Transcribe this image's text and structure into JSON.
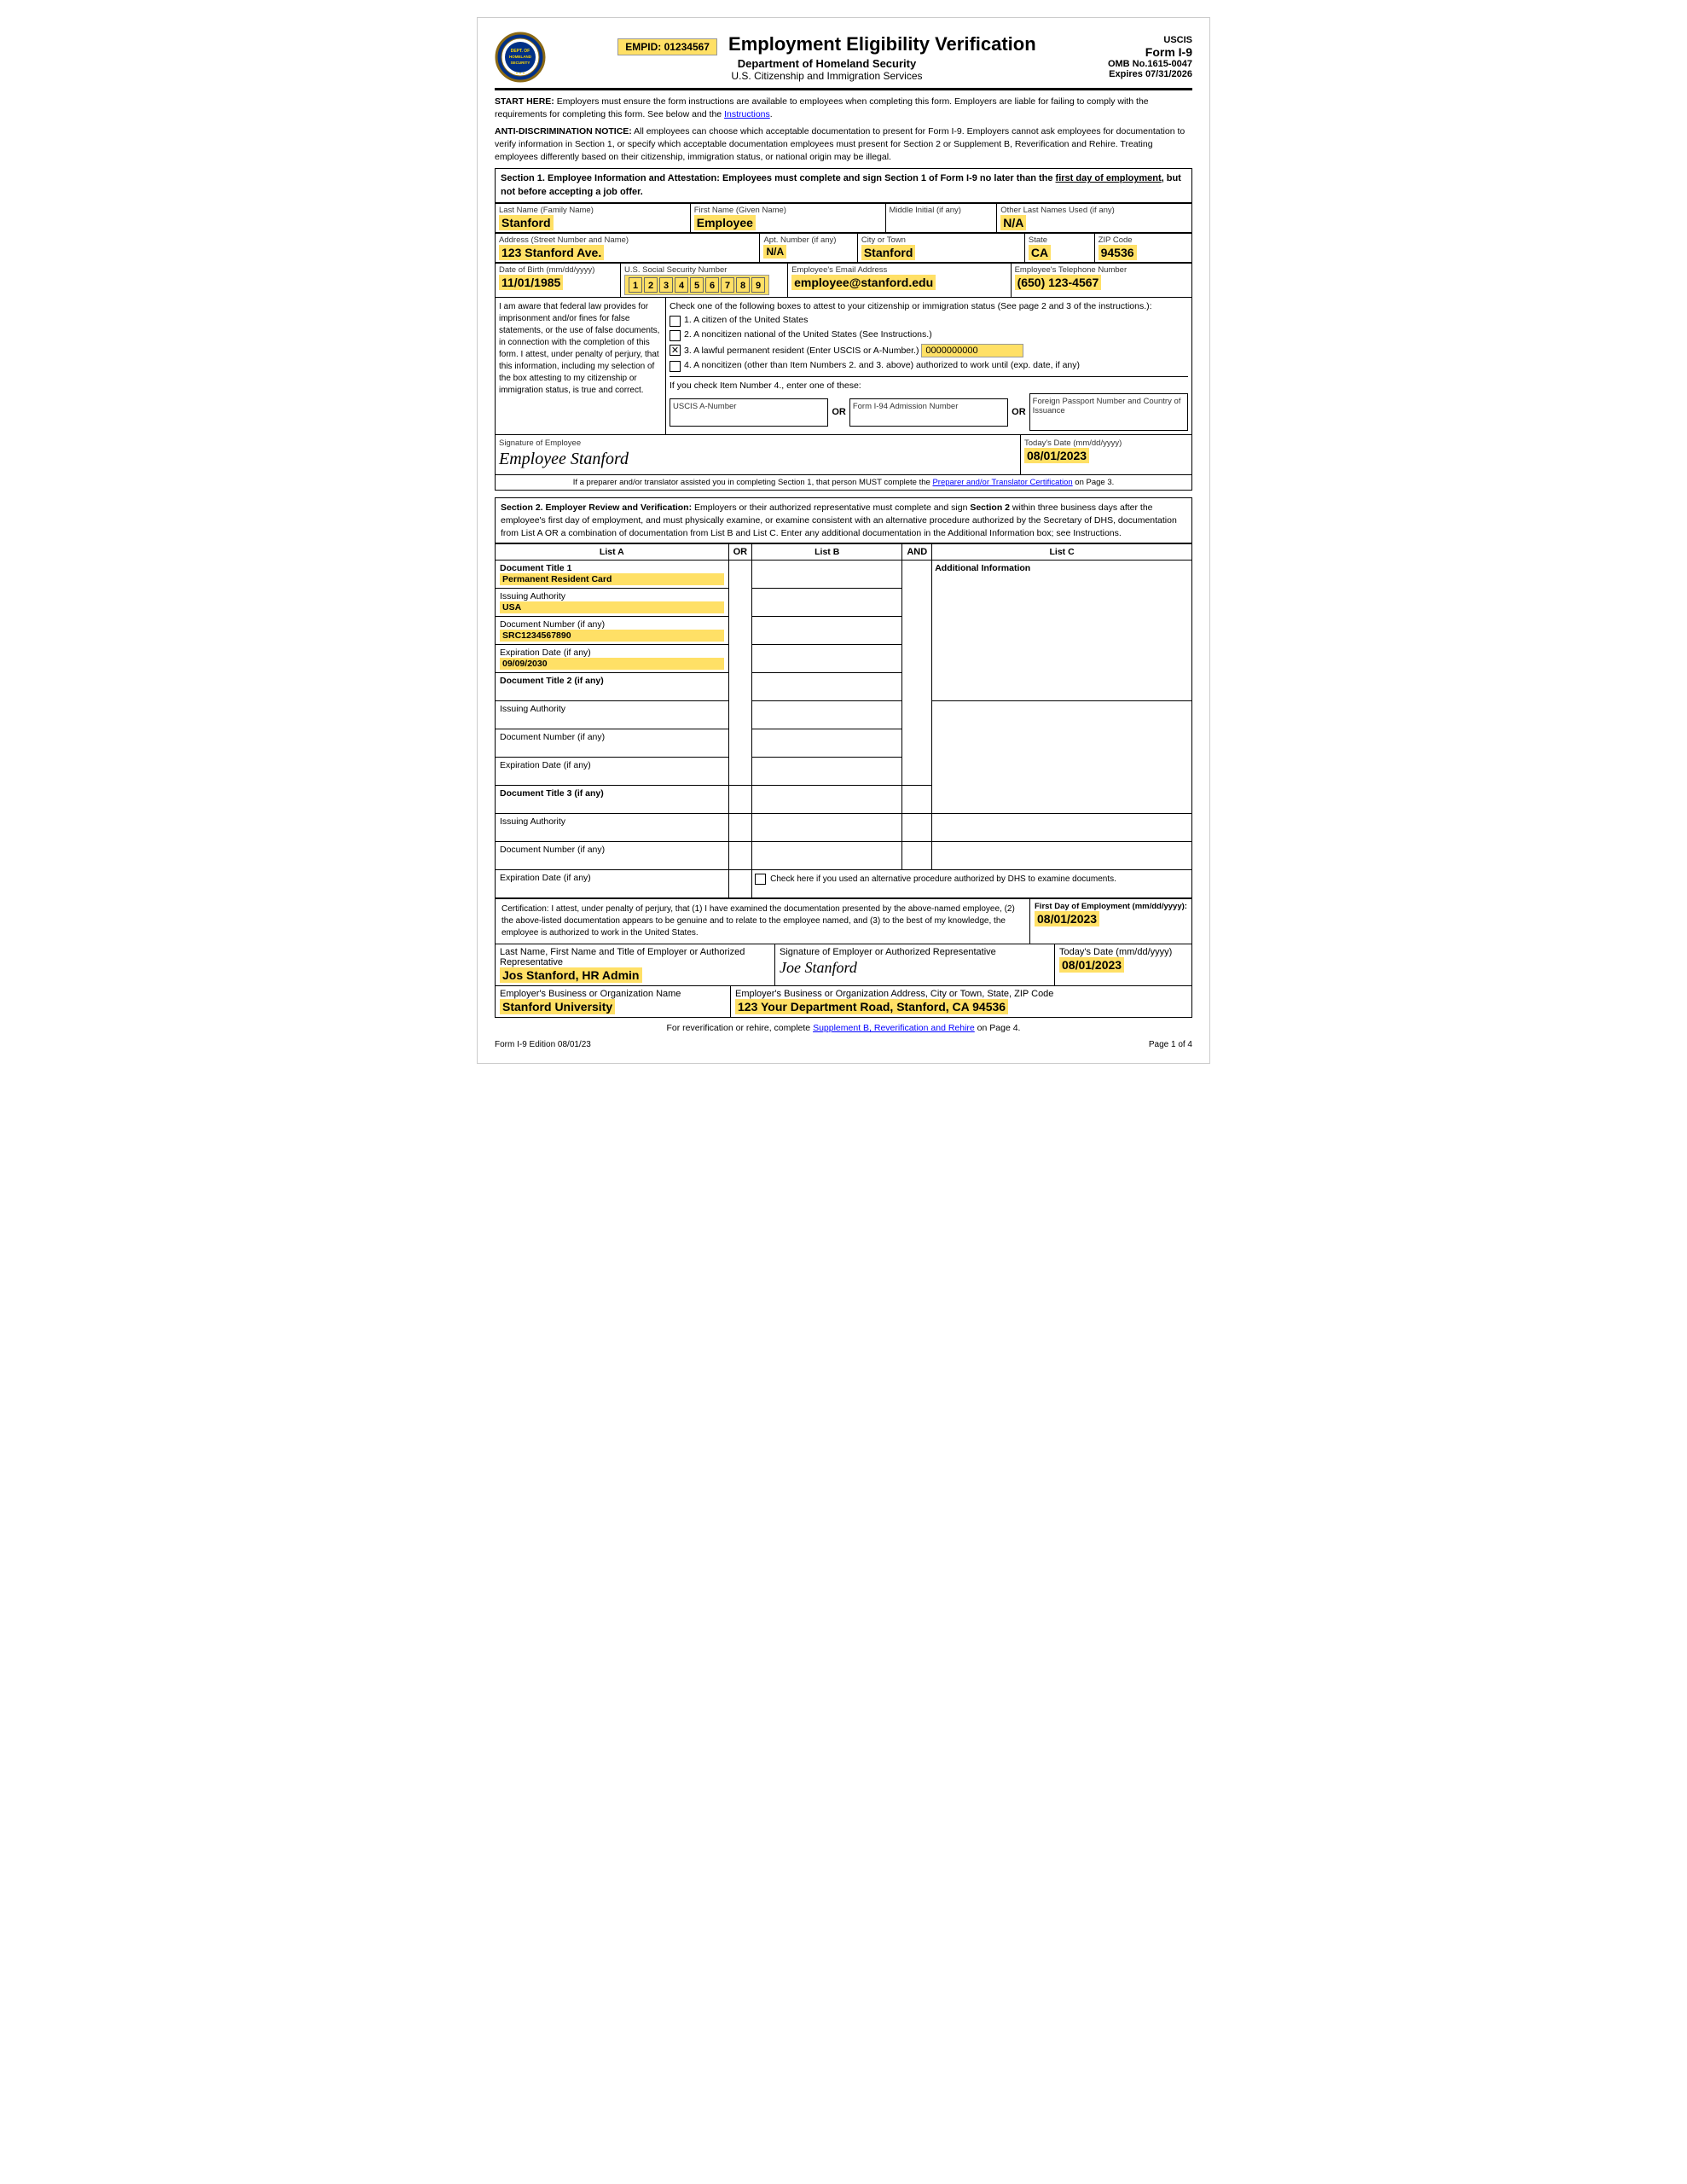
{
  "header": {
    "empid_label": "EMPID: 01234567",
    "title": "Employment Eligibility Verification",
    "dept": "Department of Homeland Security",
    "agency": "U.S. Citizenship and Immigration Services",
    "form_label": "USCIS",
    "form_num": "Form I-9",
    "omb": "OMB No.1615-0047",
    "expires": "Expires 07/31/2026"
  },
  "notices": {
    "start_here": "START HERE:  Employers must ensure the form instructions are available to employees when completing this form.  Employers are liable for failing to comply with the requirements for completing this form.  See below and the Instructions.",
    "anti_disc_label": "ANTI-DISCRIMINATION NOTICE:",
    "anti_disc_text": "  All employees can choose which acceptable documentation to present for Form I-9.  Employers cannot ask employees for documentation to verify information in Section 1, or specify which acceptable documentation employees must present for Section 2 or Supplement B, Reverification and Rehire.  Treating employees differently based on their citizenship, immigration status, or national origin may be illegal."
  },
  "section1": {
    "header": "Section 1. Employee Information and Attestation:",
    "header_text": " Employees must complete and sign Section 1 of Form I-9 no later than the ",
    "header_bold": "first day of employment",
    "header_text2": ", but not before accepting a job offer.",
    "fields": {
      "last_name_label": "Last Name (Family Name)",
      "last_name_value": "Stanford",
      "first_name_label": "First Name (Given Name)",
      "first_name_value": "Employee",
      "middle_initial_label": "Middle Initial (if any)",
      "middle_initial_value": "",
      "other_names_label": "Other Last Names Used (if any)",
      "other_names_value": "N/A",
      "address_label": "Address (Street Number and Name)",
      "address_value": "123 Stanford Ave.",
      "apt_label": "Apt. Number (if any)",
      "apt_value": "N/A",
      "city_label": "City or Town",
      "city_value": "Stanford",
      "state_label": "State",
      "state_value": "CA",
      "zip_label": "ZIP Code",
      "zip_value": "94536",
      "dob_label": "Date of Birth (mm/dd/yyyy)",
      "dob_value": "11/01/1985",
      "ssn_label": "U.S. Social Security Number",
      "ssn_digits": [
        "1",
        "2",
        "3",
        "4",
        "5",
        "6",
        "7",
        "8",
        "9"
      ],
      "email_label": "Employee's Email Address",
      "email_value": "employee@stanford.edu",
      "phone_label": "Employee's Telephone Number",
      "phone_value": "(650) 123-4567"
    },
    "attestation_left": "I am aware that federal law provides for imprisonment and/or fines for false statements, or the use of false documents, in connection with the completion of this form.  I attest, under penalty of perjury, that this information, including my selection of the box attesting to my citizenship or immigration status, is true and correct.",
    "checkboxes": [
      {
        "id": 1,
        "checked": false,
        "text": "A citizen of the United States"
      },
      {
        "id": 2,
        "checked": false,
        "text": "A noncitizen national of the United States (See Instructions.)"
      },
      {
        "id": 3,
        "checked": true,
        "text": "A lawful permanent resident (Enter USCIS or A-Number.)",
        "field": "0000000000"
      },
      {
        "id": 4,
        "checked": false,
        "text": "A noncitizen (other than Item Numbers 2. and 3. above) authorized to work until (exp. date, if any)"
      }
    ],
    "item4_instruction": "If you check Item Number 4., enter one of these:",
    "uscis_a_label": "USCIS A-Number",
    "form_i94_label": "Form I-94 Admission Number",
    "passport_label": "Foreign Passport Number and Country of Issuance",
    "or_text": "OR",
    "signature_label": "Signature of Employee",
    "signature_value": "Employee Stanford",
    "todays_date_label": "Today's Date (mm/dd/yyyy)",
    "todays_date_value": "08/01/2023",
    "preparer_notice": "If a preparer and/or translator assisted you in completing Section 1, that person MUST complete the Preparer and/or Translator Certification on Page 3."
  },
  "section2": {
    "header": "Section 2. Employer Review and Verification:",
    "header_text": " Employers or their authorized representative must complete and sign Section 2 within three business days after the employee's first day of employment, and must physically examine, or examine consistent with an alternative procedure authorized by the Secretary of DHS, documentation from List A OR a combination of documentation from List B and List C.  Enter any additional documentation in the Additional Information box; see Instructions.",
    "list_a_label": "List A",
    "list_b_label": "List B",
    "list_c_label": "List C",
    "or_label": "OR",
    "and_label": "AND",
    "additional_info_label": "Additional Information",
    "rows": {
      "doc_title_1_label": "Document Title 1",
      "doc_title_1_value": "Permanent Resident Card",
      "issuing_auth_1_label": "Issuing Authority",
      "issuing_auth_1_value": "USA",
      "doc_num_1_label": "Document Number (if any)",
      "doc_num_1_value": "SRC1234567890",
      "exp_date_1_label": "Expiration Date (if any)",
      "exp_date_1_value": "09/09/2030",
      "doc_title_2_label": "Document Title 2 (if any)",
      "doc_title_2_value": "",
      "issuing_auth_2_label": "Issuing Authority",
      "issuing_auth_2_value": "",
      "doc_num_2_label": "Document Number (if any)",
      "doc_num_2_value": "",
      "exp_date_2_label": "Expiration Date (if any)",
      "exp_date_2_value": "",
      "doc_title_3_label": "Document Title 3 (if any)",
      "doc_title_3_value": "",
      "issuing_auth_3_label": "Issuing Authority",
      "issuing_auth_3_value": "",
      "doc_num_3_label": "Document Number (if any)",
      "doc_num_3_value": "",
      "exp_date_3_label": "Expiration Date (if any)",
      "exp_date_3_value": ""
    },
    "alt_proc_text": "Check here if you used an alternative procedure authorized by DHS to examine documents.",
    "cert_text": "Certification: I attest, under penalty of perjury, that (1) I have examined the documentation presented by the above-named employee, (2) the above-listed documentation appears to be genuine and to relate to the employee named, and (3) to the best of my knowledge, the employee is authorized to work in the United States.",
    "first_day_label": "First Day of Employment (mm/dd/yyyy):",
    "first_day_value": "08/01/2023",
    "employer_name_label": "Last Name, First Name and Title of Employer or Authorized Representative",
    "employer_name_value": "Jos Stanford, HR Admin",
    "employer_sig_label": "Signature of Employer or Authorized Representative",
    "employer_sig_value": "Joe Stanford",
    "todays_date_label": "Today's Date (mm/dd/yyyy)",
    "todays_date_value": "08/01/2023",
    "org_name_label": "Employer's Business or Organization Name",
    "org_name_value": "Stanford University",
    "org_address_label": "Employer's Business or Organization Address, City or Town, State, ZIP Code",
    "org_address_value": "123 Your Department Road, Stanford, CA 94536"
  },
  "footer": {
    "supplement_text": "For reverification or rehire, complete ",
    "supplement_link": "Supplement B, Reverification and Rehire",
    "supplement_suffix": " on Page 4.",
    "edition": "Form I-9  Edition  08/01/23",
    "page": "Page 1 of 4"
  }
}
